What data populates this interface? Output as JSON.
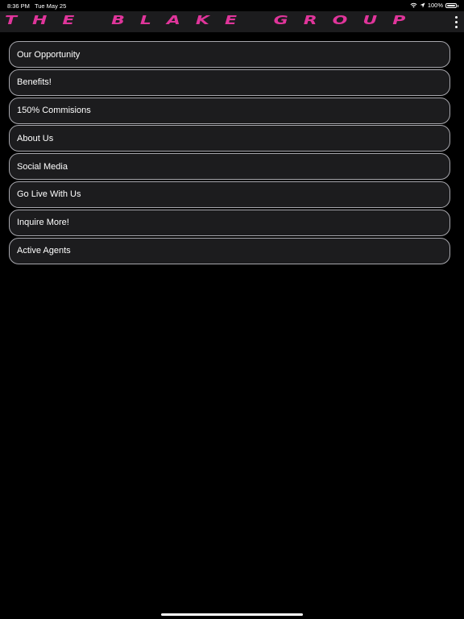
{
  "status_bar": {
    "time": "8:36 PM",
    "date": "Tue May 25",
    "battery": "100%"
  },
  "header": {
    "title": "THE BLAKE GROUP",
    "title_color": "#e0359b"
  },
  "menu": {
    "items": [
      {
        "label": "Our Opportunity"
      },
      {
        "label": "Benefits!"
      },
      {
        "label": "150% Commisions"
      },
      {
        "label": "About Us"
      },
      {
        "label": "Social Media"
      },
      {
        "label": "Go Live With Us"
      },
      {
        "label": "Inquire More!"
      },
      {
        "label": "Active Agents"
      }
    ]
  },
  "icons": {
    "wifi": "wifi-icon",
    "location": "location-arrow-icon",
    "battery": "battery-icon",
    "more": "more-vertical-icon"
  },
  "colors": {
    "background": "#000000",
    "header_bg": "#1c1c1e",
    "item_bg": "#1c1c1e",
    "item_border": "#a7a7ad",
    "accent": "#e0359b"
  }
}
